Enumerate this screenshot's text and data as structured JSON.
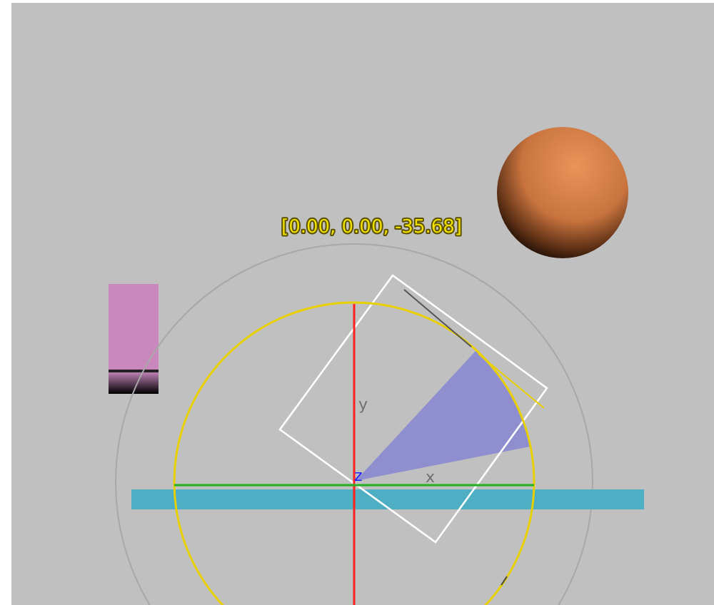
{
  "viewport": {
    "rotation_readout": "[0.00, 0.00, -35.68]",
    "axis_labels": [
      {
        "text": "y",
        "color": "#707070"
      },
      {
        "text": "x",
        "color": "#707070"
      },
      {
        "text": "z",
        "color": "#2020ff"
      }
    ]
  }
}
